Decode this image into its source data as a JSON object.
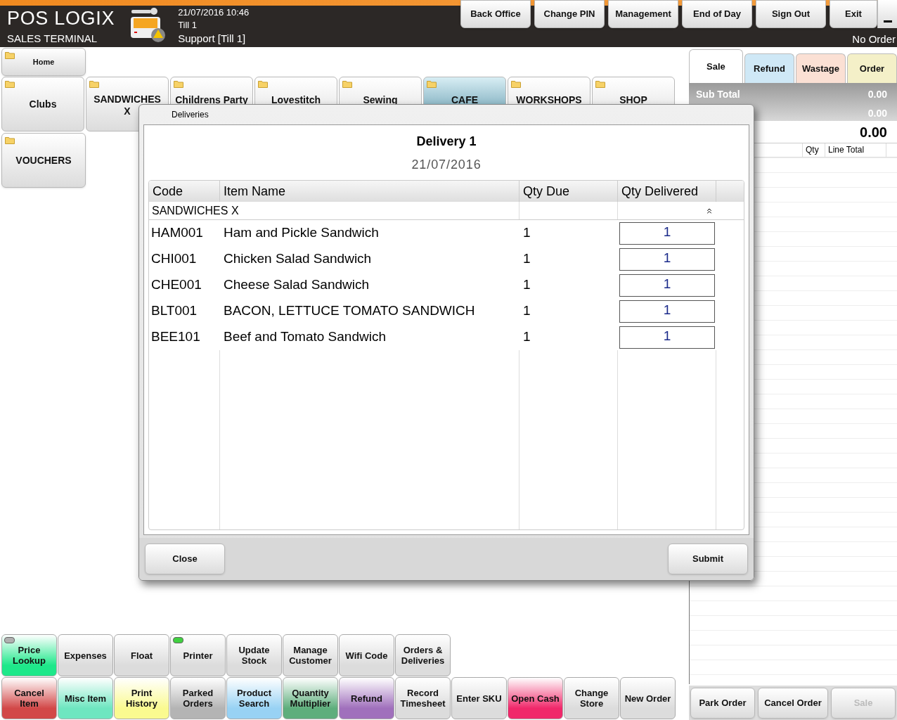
{
  "header": {
    "brand": "POS LOGIX",
    "subtitle": "SALES TERMINAL",
    "datetime": "21/07/2016 10:46",
    "till": "Till 1",
    "user": "Support [Till 1]",
    "order_status": "No Order"
  },
  "top_buttons": [
    "Back Office",
    "Change PIN",
    "Management",
    "End of Day",
    "Sign Out",
    "Exit"
  ],
  "home": "Home",
  "categories": [
    {
      "label": "Clubs",
      "selected": false
    },
    {
      "label": "SANDWICHES X",
      "selected": false
    },
    {
      "label": "Childrens Party",
      "selected": false
    },
    {
      "label": "Lovestitch",
      "selected": false
    },
    {
      "label": "Sewing",
      "selected": false
    },
    {
      "label": "CAFE",
      "selected": true
    },
    {
      "label": "WORKSHOPS",
      "selected": false
    },
    {
      "label": "SHOP",
      "selected": false
    }
  ],
  "vouchers": "VOUCHERS",
  "function_rows": [
    [
      {
        "label": "Price Lookup",
        "color": "#1ee88a",
        "light_on": false
      },
      {
        "label": "Expenses",
        "color": "#dcdcdc"
      },
      {
        "label": "Float",
        "color": "#dcdcdc"
      },
      {
        "label": "Printer",
        "color": "#dcdcdc",
        "light_on": true
      },
      {
        "label": "Update Stock",
        "color": "#dcdcdc"
      },
      {
        "label": "Manage Customer",
        "color": "#dcdcdc"
      },
      {
        "label": "Wifi Code",
        "color": "#dcdcdc"
      },
      {
        "label": "Orders & Deliveries",
        "color": "#dcdcdc"
      }
    ],
    [
      {
        "label": "Cancel Item",
        "color": "#d24848"
      },
      {
        "label": "Misc Item",
        "color": "#6ee6c0"
      },
      {
        "label": "Print History",
        "color": "#fafa90"
      },
      {
        "label": "Parked Orders",
        "color": "#b4b4b4"
      },
      {
        "label": "Product Search",
        "color": "#98d2f4"
      },
      {
        "label": "Quantity Multiplier",
        "color": "#5eae7c"
      },
      {
        "label": "Refund",
        "color": "#a070bc"
      },
      {
        "label": "Record Timesheet",
        "color": "#dcdcdc"
      },
      {
        "label": "Enter SKU",
        "color": "#dcdcdc"
      },
      {
        "label": "Open Cash",
        "color": "#f0286a"
      },
      {
        "label": "Change Store",
        "color": "#dcdcdc"
      },
      {
        "label": "New Order",
        "color": "#dcdcdc"
      }
    ]
  ],
  "order_panel": {
    "tabs": [
      {
        "label": "Sale",
        "selected": true,
        "color": "#ffffff"
      },
      {
        "label": "Refund",
        "selected": false,
        "color": "#cfe8f6"
      },
      {
        "label": "Wastage",
        "selected": false,
        "color": "#fbe0d4"
      },
      {
        "label": "Order",
        "selected": false,
        "color": "#f4f0c8"
      }
    ],
    "sub_total_label": "Sub Total",
    "sub_total": "0.00",
    "tax": "0.00",
    "total": "0.00",
    "columns": [
      "Qty",
      "Line Total"
    ],
    "buttons": [
      {
        "label": "Park Order",
        "disabled": false
      },
      {
        "label": "Cancel Order",
        "disabled": false
      },
      {
        "label": "Sale",
        "disabled": true
      }
    ]
  },
  "dialog": {
    "title": "Deliveries",
    "heading": "Delivery 1",
    "date": "21/07/2016",
    "columns": [
      "Code",
      "Item Name",
      "Qty Due",
      "Qty Delivered"
    ],
    "group": {
      "label": "SANDWICHES X",
      "expanded": true
    },
    "rows": [
      {
        "code": "HAM001",
        "name": "Ham and Pickle Sandwich",
        "due": "1",
        "delivered": "1"
      },
      {
        "code": "CHI001",
        "name": "Chicken Salad Sandwich",
        "due": "1",
        "delivered": "1"
      },
      {
        "code": "CHE001",
        "name": "Cheese Salad Sandwich",
        "due": "1",
        "delivered": "1"
      },
      {
        "code": "BLT001",
        "name": "BACON, LETTUCE TOMATO SANDWICH",
        "due": "1",
        "delivered": "1"
      },
      {
        "code": "BEE101",
        "name": "Beef and Tomato Sandwich",
        "due": "1",
        "delivered": "1"
      }
    ],
    "buttons": [
      "Close",
      "Submit"
    ]
  }
}
